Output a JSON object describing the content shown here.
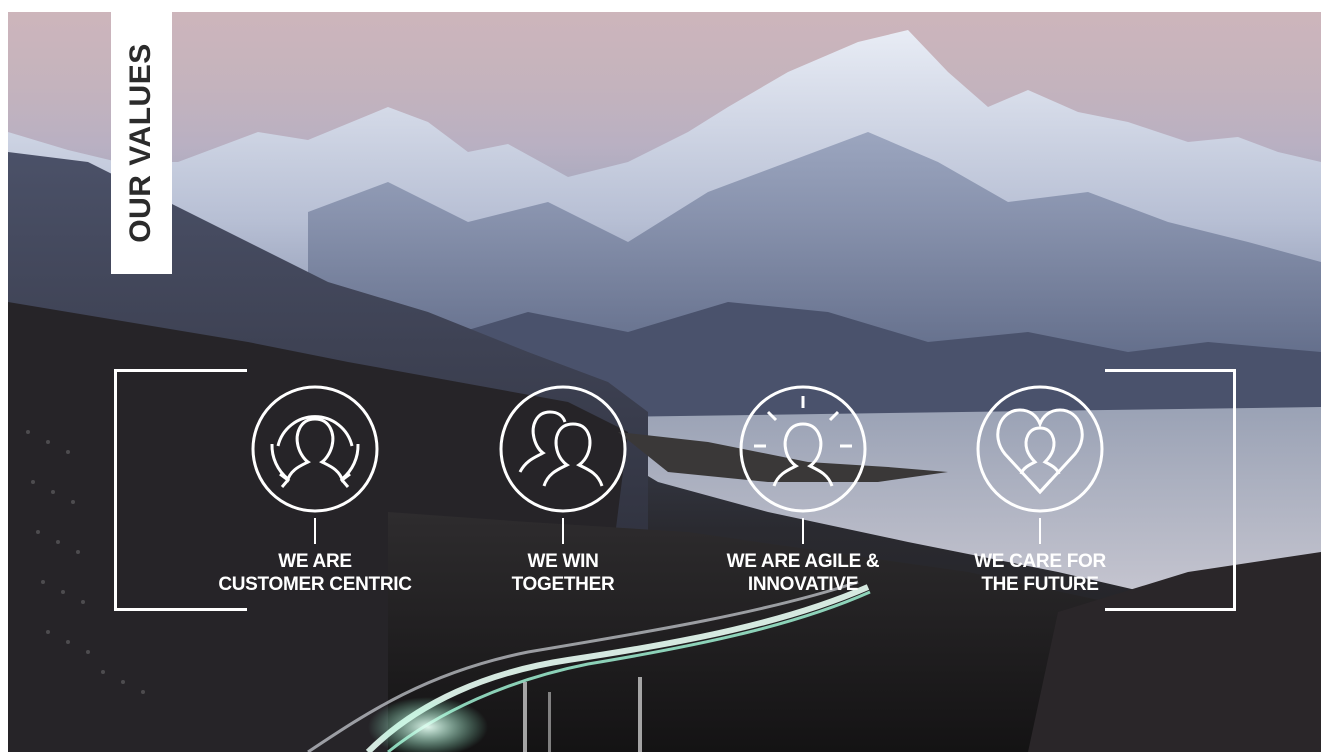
{
  "title": "OUR VALUES",
  "values": [
    {
      "line1": "WE ARE",
      "line2": "CUSTOMER CENTRIC",
      "icon": "customer-centric-icon"
    },
    {
      "line1": "WE WIN",
      "line2": "TOGETHER",
      "icon": "people-together-icon"
    },
    {
      "line1": "WE ARE AGILE &",
      "line2": "INNOVATIVE",
      "icon": "lightbulb-person-icon"
    },
    {
      "line1": "WE CARE FOR",
      "line2": "THE FUTURE",
      "icon": "heart-person-icon"
    }
  ],
  "colors": {
    "accent": "#ffffff",
    "title_text": "#2b2b2b",
    "road_glow": "#bfffe8"
  }
}
